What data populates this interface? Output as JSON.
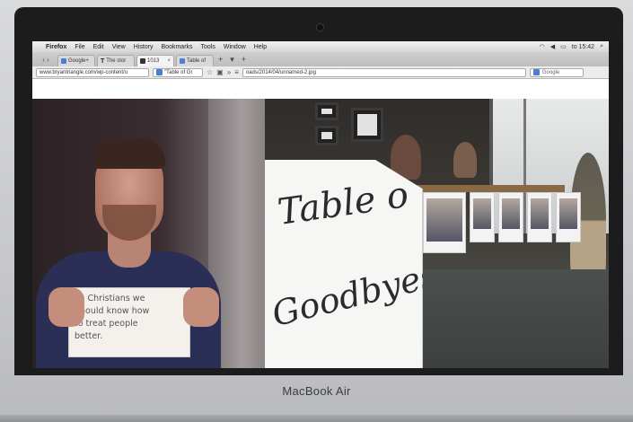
{
  "device": {
    "brand": "MacBook Air"
  },
  "menubar": {
    "app": "Firefox",
    "items": [
      "File",
      "Edit",
      "View",
      "History",
      "Bookmarks",
      "Tools",
      "Window",
      "Help"
    ],
    "clock": "to 15:42"
  },
  "tabs": [
    {
      "label": "Google+",
      "active": false
    },
    {
      "label": "The stor",
      "active": false
    },
    {
      "label": "1013",
      "active": true
    },
    {
      "label": "Table of",
      "active": false
    }
  ],
  "navbar": {
    "url_left": "www.bryantriangle.com/wp-content/u",
    "url_mid": "\"Table of Gr",
    "url_right": "oads/2014/04/unnamed-2.jpg",
    "search_placeholder": "Google"
  },
  "content": {
    "sign_left_lines": [
      "As Christians we",
      "Should know how",
      "to treat people",
      "better."
    ],
    "sign_right_line1": "Table o",
    "sign_right_line2": "Goodbyes"
  }
}
